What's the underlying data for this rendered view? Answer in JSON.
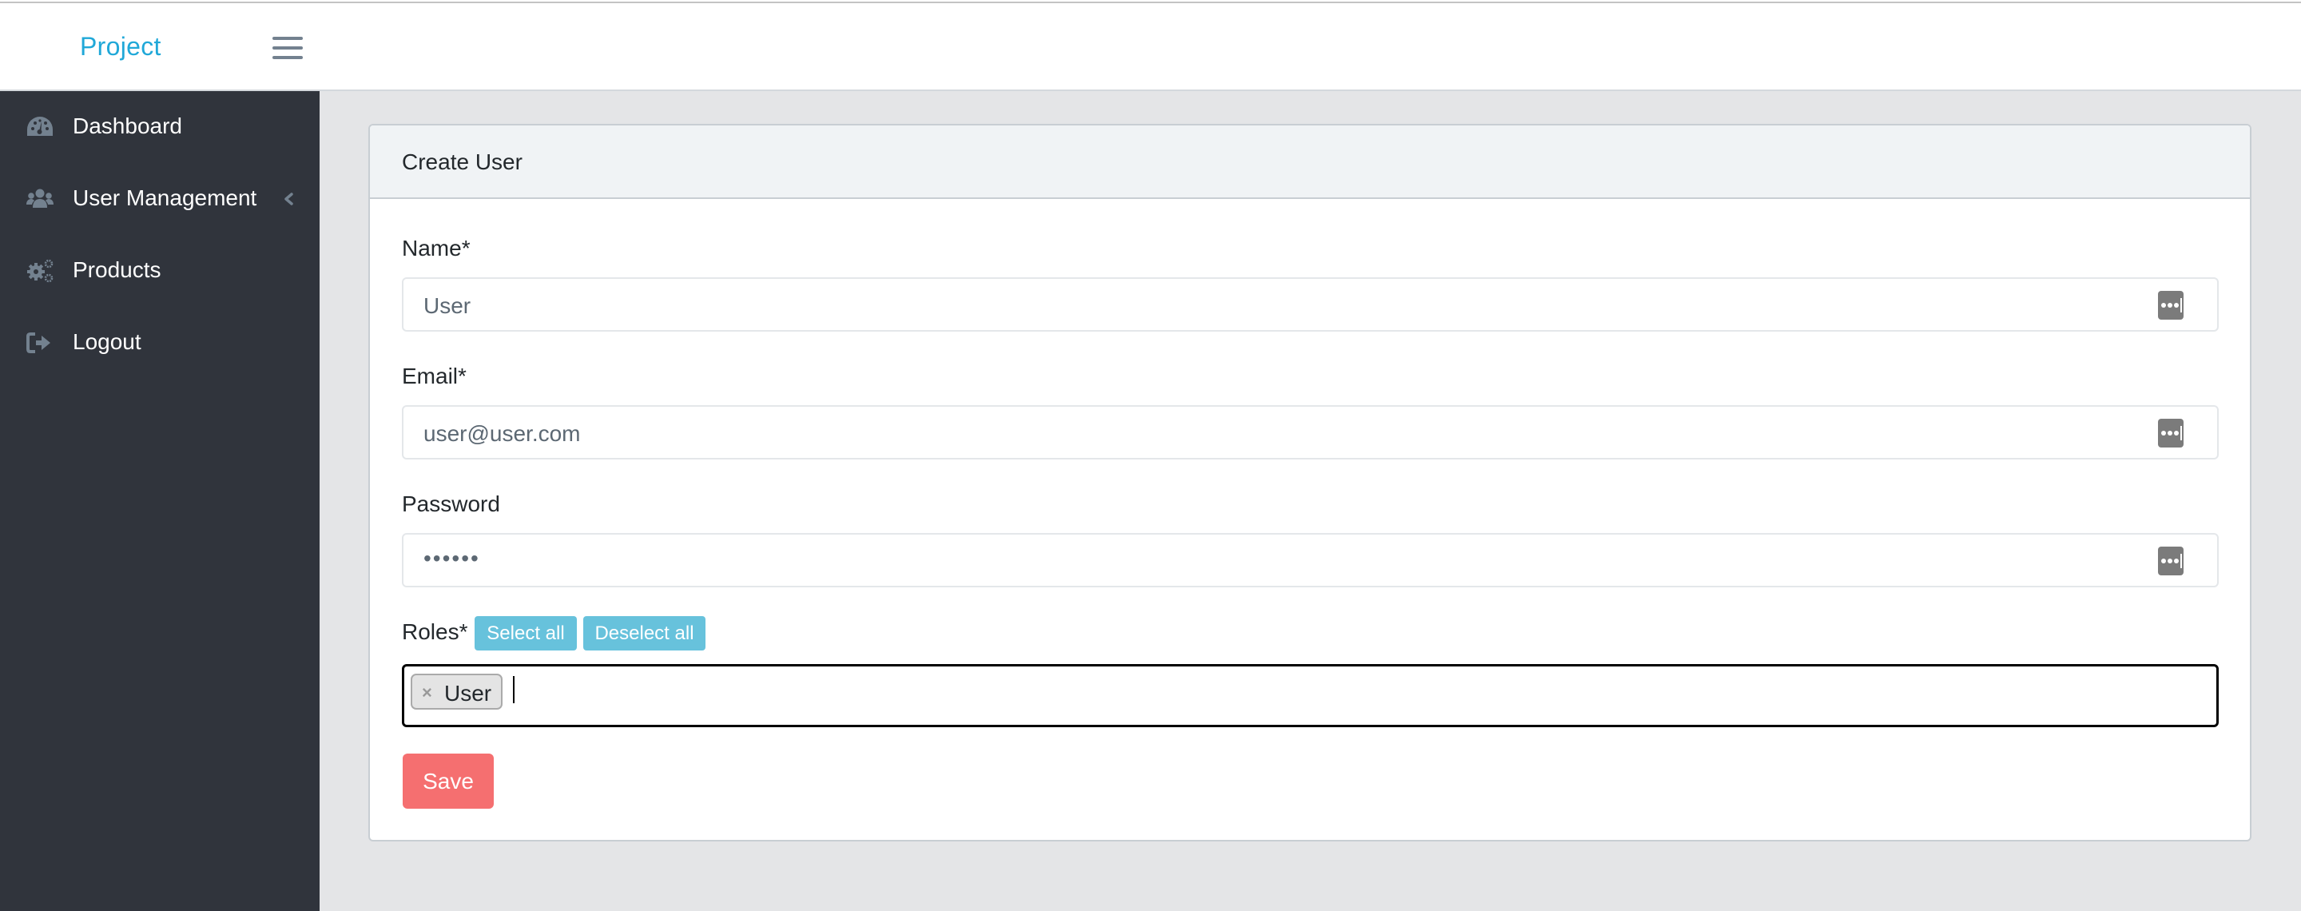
{
  "header": {
    "brand": "Project",
    "menu_icon": "hamburger-icon"
  },
  "sidebar": {
    "items": [
      {
        "label": "Dashboard",
        "icon": "dashboard-gauge-icon"
      },
      {
        "label": "User Management",
        "icon": "users-icon",
        "has_submenu": true,
        "chevron_icon": "chevron-left-icon"
      },
      {
        "label": "Products",
        "icon": "cogs-icon"
      },
      {
        "label": "Logout",
        "icon": "sign-out-icon"
      }
    ]
  },
  "card": {
    "title": "Create User",
    "fields": {
      "name": {
        "label": "Name*",
        "value": "User"
      },
      "email": {
        "label": "Email*",
        "value": "user@user.com"
      },
      "password": {
        "label": "Password",
        "value": "••••••"
      },
      "roles": {
        "label": "Roles*",
        "select_all_label": "Select all",
        "deselect_all_label": "Deselect all",
        "selected": [
          {
            "label": "User",
            "remove_glyph": "×"
          }
        ]
      }
    },
    "save_label": "Save"
  },
  "colors": {
    "brand": "#20a8d8",
    "sidebar_bg": "#30343c",
    "info_button": "#67c2dc",
    "save_button": "#f56f70",
    "page_bg": "#e4e5e7"
  }
}
